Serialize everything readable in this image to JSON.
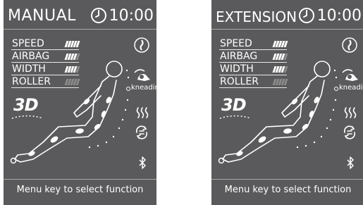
{
  "screens": [
    {
      "mode_title": "MANUAL",
      "clock_time": "10:00",
      "settings": [
        {
          "label": "SPEED",
          "level": 5,
          "max": 5
        },
        {
          "label": "AIRBAG",
          "level": 4,
          "max": 5
        },
        {
          "label": "WIDTH",
          "level": 4,
          "max": 5
        },
        {
          "label": "ROLLER",
          "level": 0,
          "max": 5
        }
      ],
      "three_d_label": "3D",
      "kneading_label": "kneading",
      "footer_text": "Menu key to select function"
    },
    {
      "mode_title": "EXTENSION",
      "clock_time": "10:00",
      "settings": [
        {
          "label": "SPEED",
          "level": 5,
          "max": 5
        },
        {
          "label": "AIRBAG",
          "level": 4,
          "max": 5
        },
        {
          "label": "WIDTH",
          "level": 4,
          "max": 5
        },
        {
          "label": "ROLLER",
          "level": 0,
          "max": 5
        }
      ],
      "three_d_label": "3D",
      "kneading_label": "kneading",
      "footer_text": "Menu key to select function"
    }
  ],
  "icons": {
    "clock": "clock-icon",
    "spine": "spine-icon",
    "kneading": "kneading-icon",
    "heat": "heat-icon",
    "swing": "swing-icon",
    "bluetooth": "bluetooth-icon"
  },
  "colors": {
    "panel_bg": "#5a5a5c",
    "foreground": "#ffffff",
    "inactive_bar": "#8b8b8b"
  }
}
